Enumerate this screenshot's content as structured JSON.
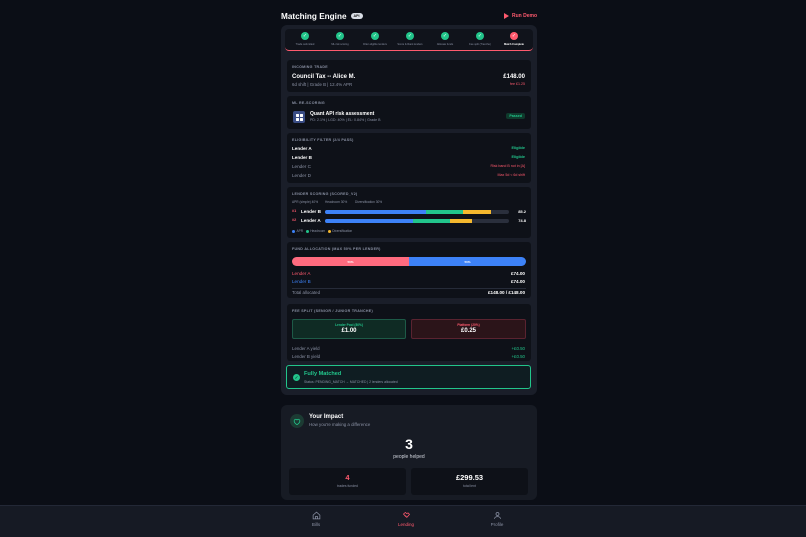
{
  "header": {
    "title": "Matching Engine",
    "badge": "API",
    "run_demo": "Run Demo"
  },
  "steps": [
    {
      "label": "Trade submitted",
      "active": false
    },
    {
      "label": "ML risk scoring",
      "active": false
    },
    {
      "label": "Filter eligible lenders",
      "active": false
    },
    {
      "label": "Score & Rank lenders",
      "active": false
    },
    {
      "label": "Allocate funds",
      "active": false
    },
    {
      "label": "Fee split (Tranche)",
      "active": false
    },
    {
      "label": "Match Complete",
      "active": true
    }
  ],
  "incoming": {
    "section": "INCOMING TRADE",
    "name": "Council Tax -- Alice M.",
    "details": "6d shift | Grade B | 12.4% APR",
    "amount": "£148.00",
    "fee": "fee £1.25"
  },
  "ml": {
    "section": "ML RE-SCORING",
    "name": "Quant API risk assessment",
    "details": "PD: 2.1% | LGD: 40% | EL: 0.84% | Grade B",
    "status": "Passed"
  },
  "eligibility": {
    "section": "ELIGIBILITY FILTER (2/4 PASS)",
    "rows": [
      {
        "name": "Lender A",
        "result": "Eligible",
        "pass": true
      },
      {
        "name": "Lender B",
        "result": "Eligible",
        "pass": true
      },
      {
        "name": "Lender C",
        "result": "Risk band B not in [A]",
        "pass": false
      },
      {
        "name": "Lender D",
        "result": "Max 5d < 6d shift",
        "pass": false
      }
    ]
  },
  "scoring": {
    "section": "LENDER SCORING (SCORED_V2)",
    "weights": [
      "APR (simple) 40%",
      "Headroom 30%",
      "Diversification 30%"
    ],
    "rows": [
      {
        "rank": "#1",
        "name": "Lender B",
        "score": "85.2",
        "value": 85.2,
        "parts": [
          0.55,
          0.2,
          0.15
        ]
      },
      {
        "rank": "#2",
        "name": "Lender A",
        "score": "74.8",
        "value": 74.8,
        "parts": [
          0.48,
          0.2,
          0.12
        ]
      }
    ],
    "legend": [
      "APR",
      "Headroom",
      "Diversification"
    ],
    "colors": {
      "apr": "#3d82f7",
      "headroom": "#22c58b",
      "diversification": "#f5b82e"
    }
  },
  "allocation": {
    "section": "FUND ALLOCATION (MAX 50% PER LENDER)",
    "split": [
      {
        "label": "50%",
        "fraction": 0.5,
        "color": "#ff6b7f"
      },
      {
        "label": "50%",
        "fraction": 0.5,
        "color": "#3d82f7"
      }
    ],
    "rows": [
      {
        "name": "Lender A",
        "amount": "£74.00"
      },
      {
        "name": "Lender B",
        "amount": "£74.00"
      }
    ],
    "total_label": "Total allocated",
    "total_value": "£148.00 / £148.00"
  },
  "fees": {
    "section": "FEE SPLIT (SENIOR / JUNIOR TRANCHE)",
    "lender_label": "Lender Pool (80%)",
    "lender_value": "£1.00",
    "platform_label": "Platform (20%)",
    "platform_value": "£0.25",
    "yields": [
      {
        "name": "Lender A yield",
        "value": "+£0.50"
      },
      {
        "name": "Lender B yield",
        "value": "+£0.50"
      }
    ]
  },
  "matched": {
    "title": "Fully Matched",
    "details": "Status: PENDING_MATCH → MATCHED | 2 lenders allocated"
  },
  "impact": {
    "title": "Your Impact",
    "subtitle": "How you're making a difference",
    "count": "3",
    "count_label": "people helped",
    "stat1_value": "4",
    "stat1_label": "trades funded",
    "stat2_value": "£299.53",
    "stat2_label": "total lent"
  },
  "nav": [
    {
      "label": "Bills",
      "active": false
    },
    {
      "label": "Lending",
      "active": true
    },
    {
      "label": "Profile",
      "active": false
    }
  ]
}
